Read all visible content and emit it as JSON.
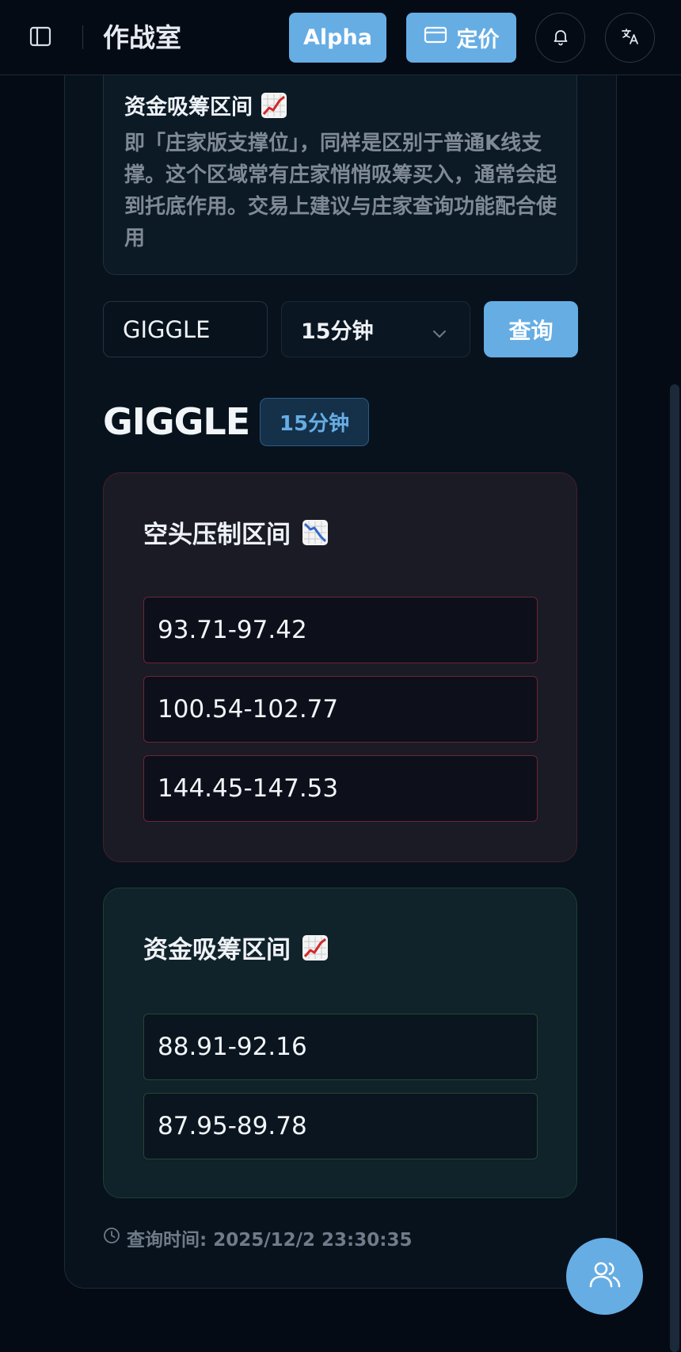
{
  "header": {
    "title": "作战室",
    "alpha_label": "Alpha",
    "pricing_label": "定价",
    "icons": {
      "sidebar": "sidebar-toggle-icon",
      "card": "credit-card-icon",
      "bell": "bell-icon",
      "language": "translate-icon"
    }
  },
  "info_card": {
    "title": "资金吸筹区间",
    "description": "即「庄家版支撑位」，同样是区别于普通K线支撑。这个区域常有庄家悄悄吸筹买入，通常会起到托底作用。交易上建议与庄家查询功能配合使用"
  },
  "query": {
    "symbol_value": "GIGGLE",
    "interval_value": "15分钟",
    "button_label": "查询"
  },
  "result": {
    "symbol": "GIGGLE",
    "interval_badge": "15分钟",
    "bear_zone": {
      "title": "空头压制区间",
      "ranges": [
        "93.71-97.42",
        "100.54-102.77",
        "144.45-147.53"
      ]
    },
    "bull_zone": {
      "title": "资金吸筹区间",
      "ranges": [
        "88.91-92.16",
        "87.95-89.78"
      ]
    },
    "query_time": "查询时间: 2025/12/2 23:30:35"
  },
  "colors": {
    "accent": "#66ade4",
    "background": "#050b15",
    "bear_border": "#6a2631",
    "bull_border": "#24482f"
  }
}
